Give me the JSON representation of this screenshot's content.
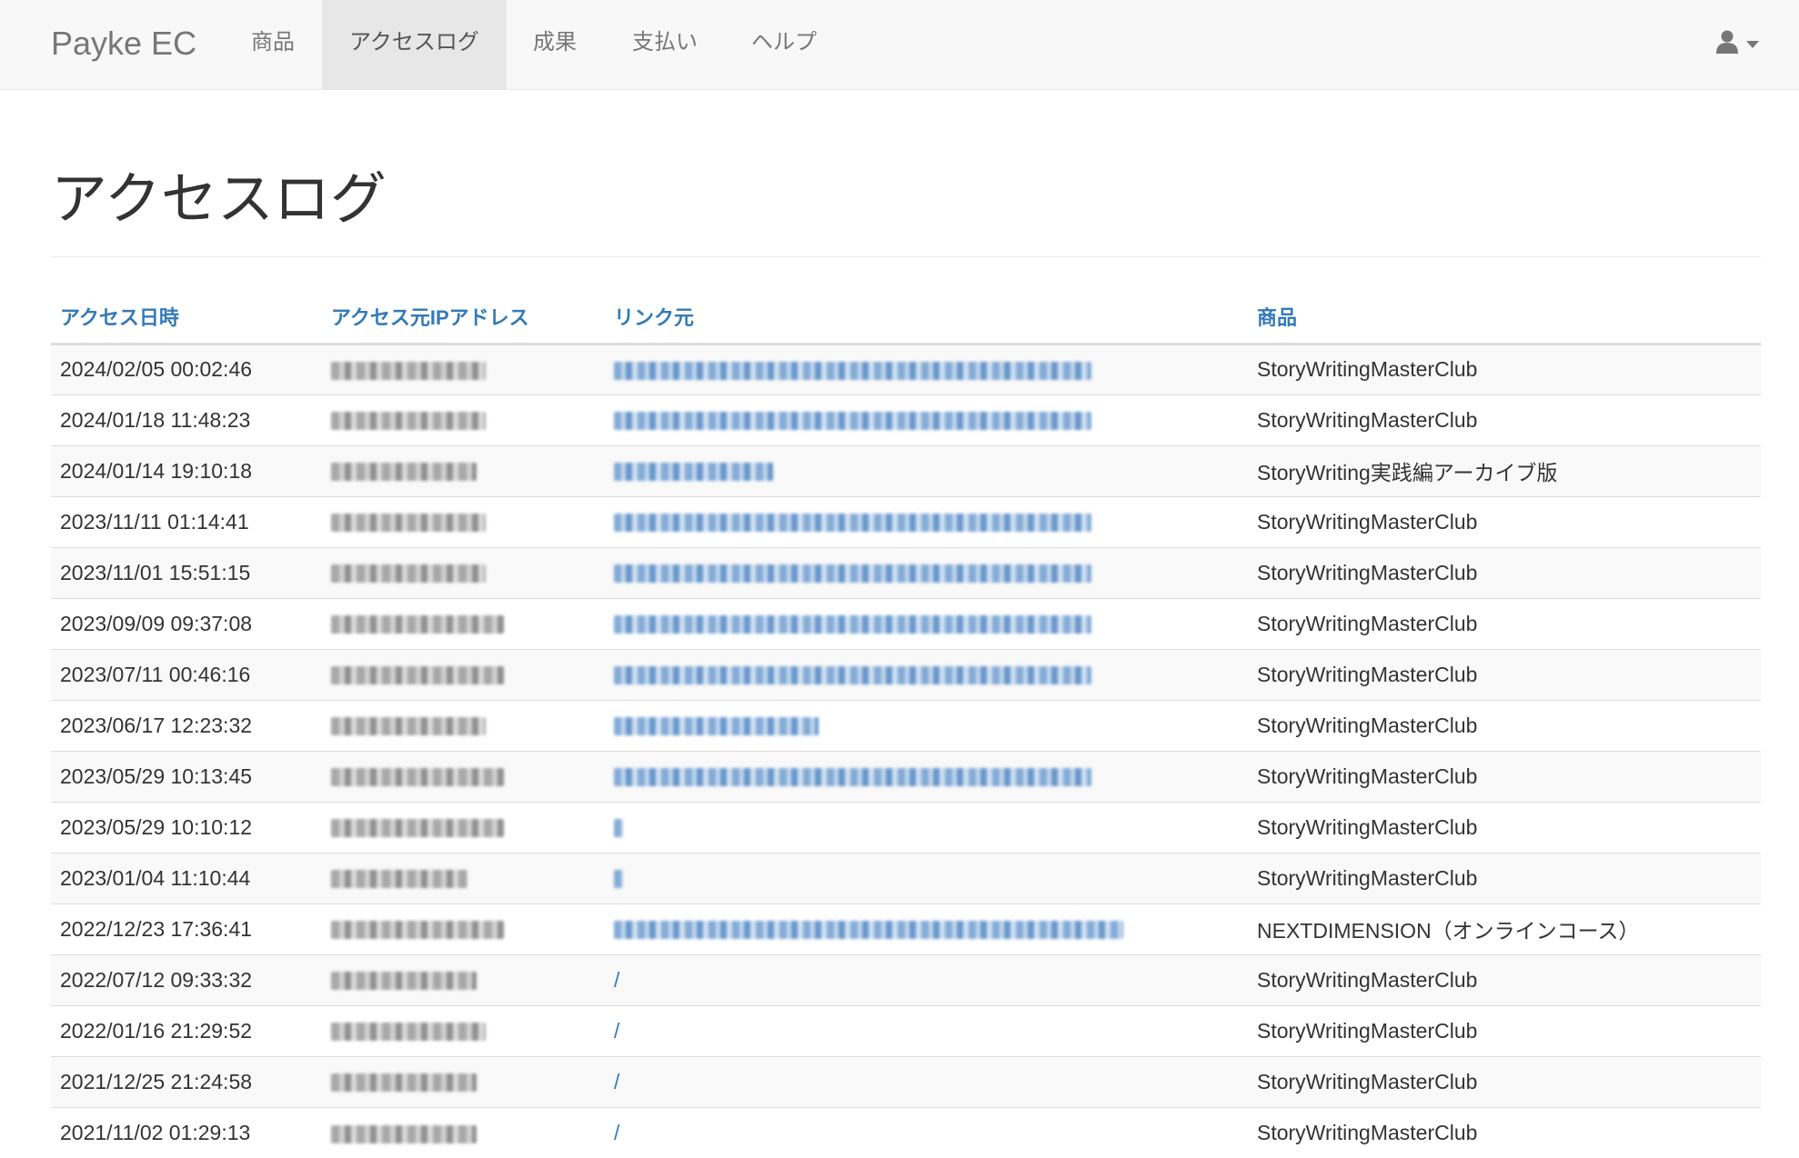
{
  "navbar": {
    "brand": "Payke EC",
    "items": [
      {
        "label": "商品"
      },
      {
        "label": "アクセスログ",
        "active": true
      },
      {
        "label": "成果"
      },
      {
        "label": "支払い"
      },
      {
        "label": "ヘルプ"
      }
    ],
    "user_icon": "user-icon"
  },
  "page": {
    "title": "アクセスログ"
  },
  "table": {
    "columns": [
      "アクセス日時",
      "アクセス元IPアドレス",
      "リンク元",
      "商品"
    ],
    "rows": [
      {
        "datetime": "2024/02/05 00:02:46",
        "product": "StoryWritingMasterClub"
      },
      {
        "datetime": "2024/01/18 11:48:23",
        "product": "StoryWritingMasterClub"
      },
      {
        "datetime": "2024/01/14 19:10:18",
        "product": "StoryWriting実践編アーカイブ版"
      },
      {
        "datetime": "2023/11/11 01:14:41",
        "product": "StoryWritingMasterClub"
      },
      {
        "datetime": "2023/11/01 15:51:15",
        "product": "StoryWritingMasterClub"
      },
      {
        "datetime": "2023/09/09 09:37:08",
        "product": "StoryWritingMasterClub"
      },
      {
        "datetime": "2023/07/11 00:46:16",
        "product": "StoryWritingMasterClub"
      },
      {
        "datetime": "2023/06/17 12:23:32",
        "product": "StoryWritingMasterClub"
      },
      {
        "datetime": "2023/05/29 10:13:45",
        "product": "StoryWritingMasterClub"
      },
      {
        "datetime": "2023/05/29 10:10:12",
        "product": "StoryWritingMasterClub"
      },
      {
        "datetime": "2023/01/04 11:10:44",
        "product": "StoryWritingMasterClub"
      },
      {
        "datetime": "2022/12/23 17:36:41",
        "product": "NEXTDIMENSION（オンラインコース）"
      },
      {
        "datetime": "2022/07/12 09:33:32",
        "referrer": "/",
        "product": "StoryWritingMasterClub"
      },
      {
        "datetime": "2022/01/16 21:29:52",
        "referrer": "/",
        "product": "StoryWritingMasterClub"
      },
      {
        "datetime": "2021/12/25 21:24:58",
        "referrer": "/",
        "product": "StoryWritingMasterClub"
      },
      {
        "datetime": "2021/11/02 01:29:13",
        "referrer": "/",
        "product": "StoryWritingMasterClub"
      }
    ]
  }
}
